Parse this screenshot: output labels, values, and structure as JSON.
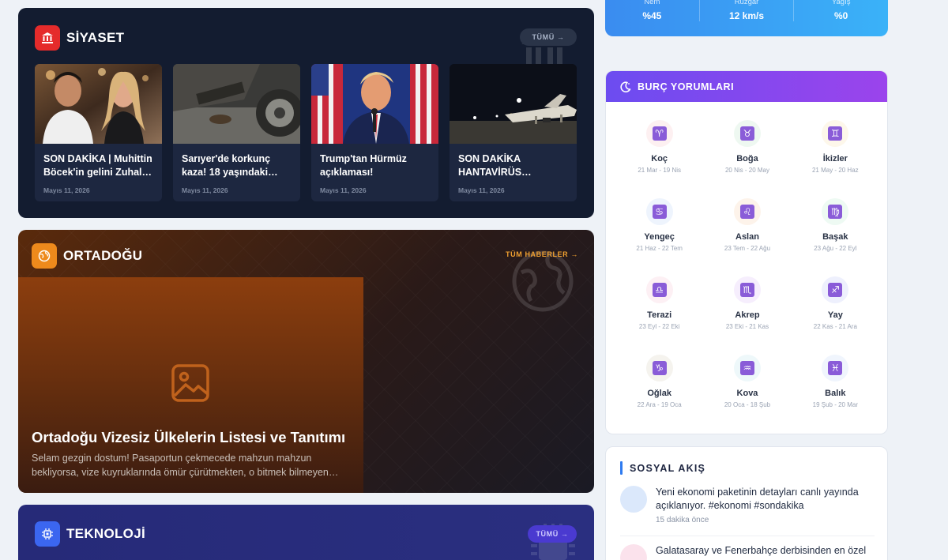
{
  "siyaset": {
    "title": "SİYASET",
    "all_label": "TÜMÜ →",
    "accent": "#e52b2b",
    "articles": [
      {
        "title": "SON DAKİKA | Muhittin Böcek'in gelini Zuhal…",
        "date": "Mayıs 11, 2026"
      },
      {
        "title": "Sarıyer'de korkunç kaza! 18 yaşındaki…",
        "date": "Mayıs 11, 2026"
      },
      {
        "title": "Trump'tan Hürmüz açıklaması! Operasyo…",
        "date": "Mayıs 11, 2026"
      },
      {
        "title": "SON DAKİKA HANTAVİRÜS…",
        "date": "Mayıs 11, 2026"
      }
    ]
  },
  "ortadogu": {
    "title": "ORTADOĞU",
    "all_label": "TÜM HABERLER →",
    "accent": "#ee8a1c",
    "feature": {
      "title": "Ortadoğu Vizesiz Ülkelerin Listesi ve Tanıtımı",
      "excerpt": "Selam gezgin dostum! Pasaportun çekmecede mahzun mahzun bekliyorsa, vize kuyruklarında ömür çürütmekten, o bitmek bilmeyen…"
    }
  },
  "teknoloji": {
    "title": "TEKNOLOJİ",
    "all_label": "TÜMÜ →",
    "accent": "#3b66f0"
  },
  "weather": {
    "stats": [
      {
        "label": "Nem",
        "value": "%45"
      },
      {
        "label": "Rüzgar",
        "value": "12 km/s"
      },
      {
        "label": "Yağış",
        "value": "%0"
      }
    ]
  },
  "burc": {
    "title": "BURÇ YORUMLARI",
    "signs": [
      {
        "name": "Koç",
        "dates": "21 Mar - 19 Nis",
        "symbol": "♈",
        "bg": "#fdf0f1"
      },
      {
        "name": "Boğa",
        "dates": "20 Nis - 20 May",
        "symbol": "♉",
        "bg": "#eef8f1"
      },
      {
        "name": "İkizler",
        "dates": "21 May - 20 Haz",
        "symbol": "♊",
        "bg": "#fdf7ea"
      },
      {
        "name": "Yengeç",
        "dates": "21 Haz - 22 Tem",
        "symbol": "♋",
        "bg": "#eef4fd"
      },
      {
        "name": "Aslan",
        "dates": "23 Tem - 22 Ağu",
        "symbol": "♌",
        "bg": "#fdf3ea"
      },
      {
        "name": "Başak",
        "dates": "23 Ağu - 22 Eyl",
        "symbol": "♍",
        "bg": "#eefaf3"
      },
      {
        "name": "Terazi",
        "dates": "23 Eyl - 22 Eki",
        "symbol": "♎",
        "bg": "#fdf0f4"
      },
      {
        "name": "Akrep",
        "dates": "23 Eki - 21 Kas",
        "symbol": "♏",
        "bg": "#f6eefd"
      },
      {
        "name": "Yay",
        "dates": "22 Kas - 21 Ara",
        "symbol": "♐",
        "bg": "#eef0fd"
      },
      {
        "name": "Oğlak",
        "dates": "22 Ara - 19 Oca",
        "symbol": "♑",
        "bg": "#f5f3ee"
      },
      {
        "name": "Kova",
        "dates": "20 Oca - 18 Şub",
        "symbol": "♒",
        "bg": "#eef8fa"
      },
      {
        "name": "Balık",
        "dates": "19 Şub - 20 Mar",
        "symbol": "♓",
        "bg": "#f0f5fd"
      }
    ]
  },
  "social": {
    "title": "SOSYAL AKIŞ",
    "posts": [
      {
        "text": "Yeni ekonomi paketinin detayları canlı yayında açıklanıyor. #ekonomi #sondakika",
        "time": "15 dakika önce",
        "avatar_color": "#dbe8fb"
      },
      {
        "text": "Galatasaray ve Fenerbahçe derbisinden en özel",
        "time": "",
        "avatar_color": "#fbe2ec"
      }
    ]
  }
}
